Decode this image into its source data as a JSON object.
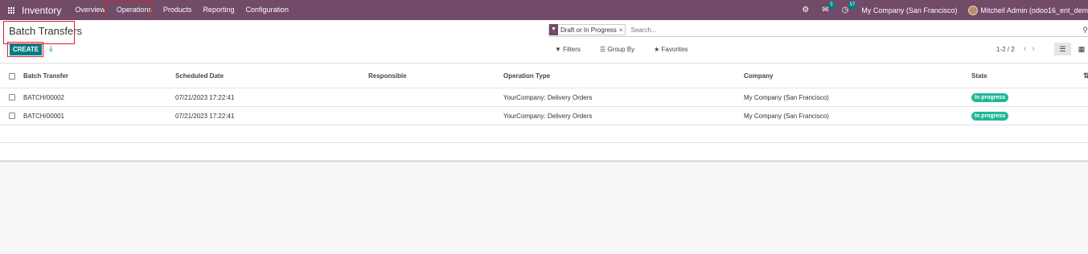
{
  "navbar": {
    "brand": "Inventory",
    "menu": [
      {
        "label": "Overview"
      },
      {
        "label": "Operations"
      },
      {
        "label": "Products"
      },
      {
        "label": "Reporting"
      },
      {
        "label": "Configuration"
      }
    ],
    "messages_count": "5",
    "activities_count": "57",
    "company": "My Company (San Francisco)",
    "user": "Mitchell Admin (odoo16_ent_dem"
  },
  "control": {
    "title": "Batch Transfers",
    "create_label": "CREATE",
    "search_facet": "Draft or In Progress",
    "search_placeholder": "Search...",
    "filters_label": "Filters",
    "group_by_label": "Group By",
    "favorites_label": "Favorites",
    "pager": "1-2 / 2"
  },
  "table": {
    "columns": [
      "Batch Transfer",
      "Scheduled Date",
      "Responsible",
      "Operation Type",
      "Company",
      "State"
    ],
    "rows": [
      {
        "name": "BATCH/00002",
        "date": "07/21/2023 17:22:41",
        "responsible": "",
        "operation_type": "YourCompany: Delivery Orders",
        "company": "My Company (San Francisco)",
        "state": "In progress"
      },
      {
        "name": "BATCH/00001",
        "date": "07/21/2023 17:22:41",
        "responsible": "",
        "operation_type": "YourCompany: Delivery Orders",
        "company": "My Company (San Francisco)",
        "state": "In progress"
      }
    ]
  },
  "colors": {
    "brand": "#714b67",
    "accent": "#017e84",
    "badge": "#21b799",
    "highlight": "#d0262e"
  }
}
